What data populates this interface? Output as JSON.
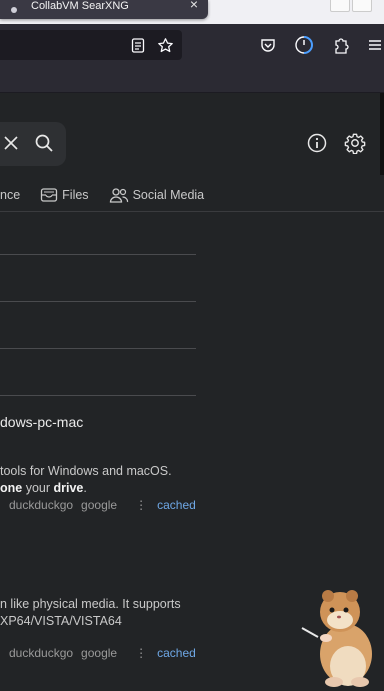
{
  "browser": {
    "tab_title": "CollabVM SearXNG",
    "tab_close": "×"
  },
  "categories": [
    {
      "label": "nce",
      "icon": "science-icon"
    },
    {
      "label": "Files",
      "icon": "files-icon"
    },
    {
      "label": "Social Media",
      "icon": "social-media-icon"
    }
  ],
  "results": [
    {
      "title": "dows-pc-mac",
      "line1": "tools for Windows and macOS.",
      "line2_bold1": "one",
      "line2_mid": " your ",
      "line2_bold2": "drive",
      "line2_end": ".",
      "engines": [
        "duckduckgo",
        "google"
      ],
      "cached": "cached"
    },
    {
      "line1": "n like physical media. It supports",
      "line2": "XP64/VISTA/VISTA64",
      "engines": [
        "duckduckgo",
        "google"
      ],
      "cached": "cached"
    }
  ],
  "colors": {
    "page_bg": "#222426",
    "toolbar_bg": "#2b2a33",
    "link": "#6fa8e6"
  }
}
